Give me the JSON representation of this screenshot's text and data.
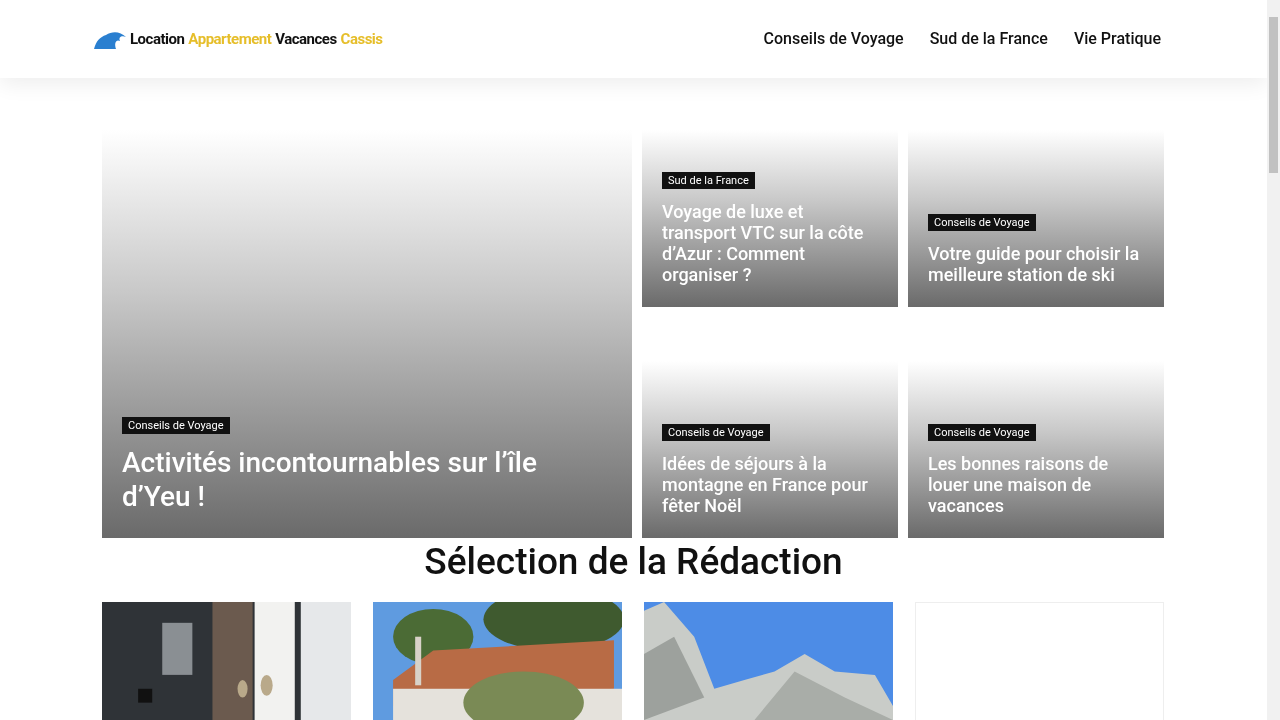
{
  "logo": {
    "words": [
      {
        "text": "Location",
        "color": "#111111"
      },
      {
        "text": "Appartement",
        "color": "#e6be2a"
      },
      {
        "text": "Vacances",
        "color": "#111111"
      },
      {
        "text": "Cassis",
        "color": "#e6be2a"
      }
    ]
  },
  "nav": [
    "Conseils de Voyage",
    "Sud de la France",
    "Vie Pratique"
  ],
  "featured": {
    "category": "Conseils de Voyage",
    "title": "Activités incontournables sur l’île d’Yeu !"
  },
  "posts": [
    {
      "category": "Sud de la France",
      "title": "Voyage de luxe et transport VTC sur la côte d’Azur : Comment organiser ?"
    },
    {
      "category": "Conseils de Voyage",
      "title": "Votre guide pour choisir la meilleure station de ski"
    },
    {
      "category": "Conseils de Voyage",
      "title": "Idées de séjours à la montagne en France pour fêter Noël"
    },
    {
      "category": "Conseils de Voyage",
      "title": "Les bonnes raisons de louer une maison de vacances"
    }
  ],
  "section": {
    "title": "Sélection de la Rédaction",
    "cards": [
      {
        "kind": "room"
      },
      {
        "kind": "house"
      },
      {
        "kind": "cliff"
      },
      {
        "kind": "empty"
      }
    ]
  }
}
